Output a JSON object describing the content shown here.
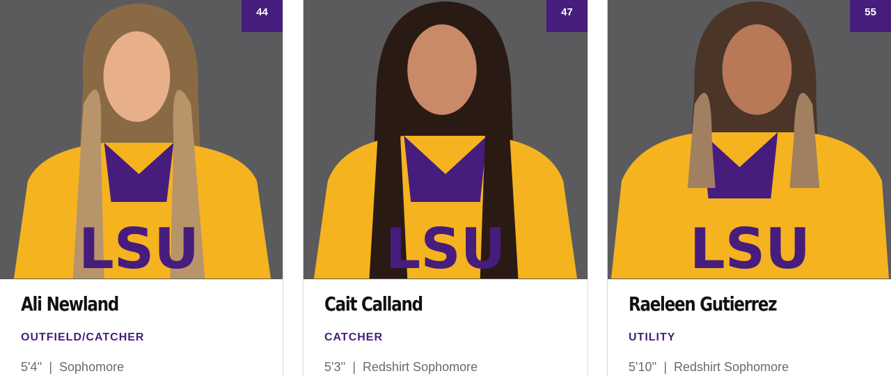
{
  "players": [
    {
      "number": "44",
      "name": "Ali Newland",
      "position": "OUTFIELD/CATCHER",
      "height": "5'4''",
      "class_year": "Sophomore"
    },
    {
      "number": "47",
      "name": "Cait Calland",
      "position": "CATCHER",
      "height": "5'3''",
      "class_year": "Redshirt Sophomore"
    },
    {
      "number": "55",
      "name": "Raeleen Gutierrez",
      "position": "UTILITY",
      "height": "5'10''",
      "class_year": "Redshirt Sophomore"
    }
  ],
  "separator": "|",
  "jersey_text": "LSU",
  "colors": {
    "purple": "#461d7c",
    "gold": "#f5b320",
    "photo_bg": "#5b5b5d"
  }
}
